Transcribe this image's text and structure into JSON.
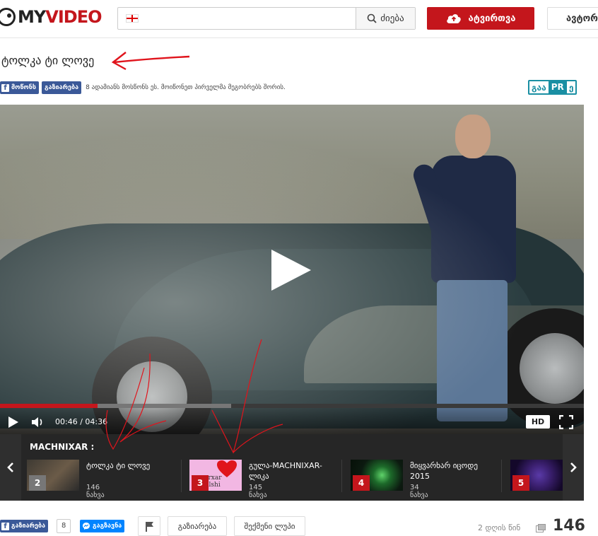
{
  "header": {
    "logo_my": "MY",
    "logo_video": "VIDEO",
    "search_placeholder": "",
    "search_label": "ძიება",
    "upload_label": "ატვირთვა",
    "login_label": "ავტორ"
  },
  "video": {
    "title": "ტოლკა ტი ლოვე"
  },
  "social": {
    "like_label": "მოწონს",
    "share_label": "გაზიარება",
    "like_text": "8 ადამიანს მოსწონს ეს. მოიწონეთ პირველმა მეგობრებს შორის."
  },
  "gaapr": {
    "part1": "გაა",
    "part2": "PR",
    "part3": "ე"
  },
  "player": {
    "time_current": "00:46",
    "time_total": "04:36",
    "time_separator": " / ",
    "progress_played_fraction": 0.1667,
    "progress_buffered_fraction": 0.3958,
    "hd_label": "HD"
  },
  "playlist": {
    "title": "MACHNIXAR :",
    "items": [
      {
        "number": "2",
        "name": "ტოლკა ტი ლოვე",
        "views": "146 ნახვა",
        "thumb_text": ""
      },
      {
        "number": "3",
        "name": "გულა-MACHNIXAR-ლიკა",
        "views": "145 ნახვა",
        "thumb_text": "varxar gulshi"
      },
      {
        "number": "4",
        "name": "მიყვარხარ იცოდე 2015",
        "views": "34 ნახვა",
        "thumb_text": ""
      },
      {
        "number": "5",
        "name": "",
        "views": "",
        "thumb_text": ""
      }
    ],
    "prev_icon": "chevron-left-icon",
    "next_icon": "chevron-right-icon"
  },
  "bottom": {
    "share_label": "გაზიარება",
    "share_count": "8",
    "messenger_label": "გაგზავნა",
    "flag_icon": "flag-icon",
    "share_button": "გაზიარება",
    "playlist_button": "შექმენი ლუპი",
    "date": "2 დღის წინ",
    "views": "146"
  },
  "colors": {
    "brand_red": "#c4161c",
    "facebook_blue": "#3b5998",
    "messenger_blue": "#0084ff",
    "gaapr_teal": "#1a8fa3",
    "annotation_red": "#e0141c"
  }
}
